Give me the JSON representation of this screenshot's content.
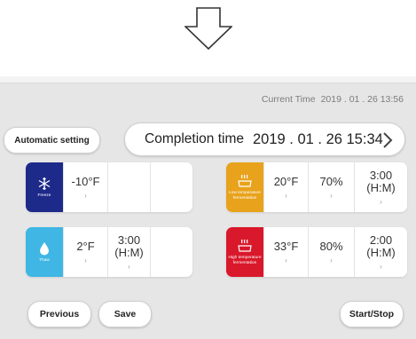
{
  "current_time": {
    "label": "Current Time",
    "value": "2019 . 01 . 26  13:56"
  },
  "automatic_setting": "Automatic setting",
  "completion": {
    "label": "Completion time",
    "value": "2019 . 01 . 26  15:34"
  },
  "cards": [
    {
      "mode": "Freeze",
      "icon": "snowflake-icon",
      "color": "#1e2a8a",
      "values": [
        "-10°F",
        "",
        ""
      ]
    },
    {
      "mode": "Low temperature fermentation",
      "icon": "steam-pot-icon",
      "color": "#e8a21b",
      "values": [
        "20°F",
        "70%",
        "3:00 (H:M)"
      ]
    },
    {
      "mode": "Thaw",
      "icon": "water-drop-icon",
      "color": "#3fb6e4",
      "values": [
        "2°F",
        "3:00 (H:M)",
        ""
      ]
    },
    {
      "mode": "High temperature fermentation",
      "icon": "steam-pot-icon",
      "color": "#d9182b",
      "values": [
        "33°F",
        "80%",
        "2:00 (H:M)"
      ]
    }
  ],
  "buttons": {
    "previous": "Previous",
    "save": "Save",
    "start_stop": "Start/Stop"
  },
  "colors": {
    "background": "#e6e6e6",
    "card": "#ffffff"
  }
}
